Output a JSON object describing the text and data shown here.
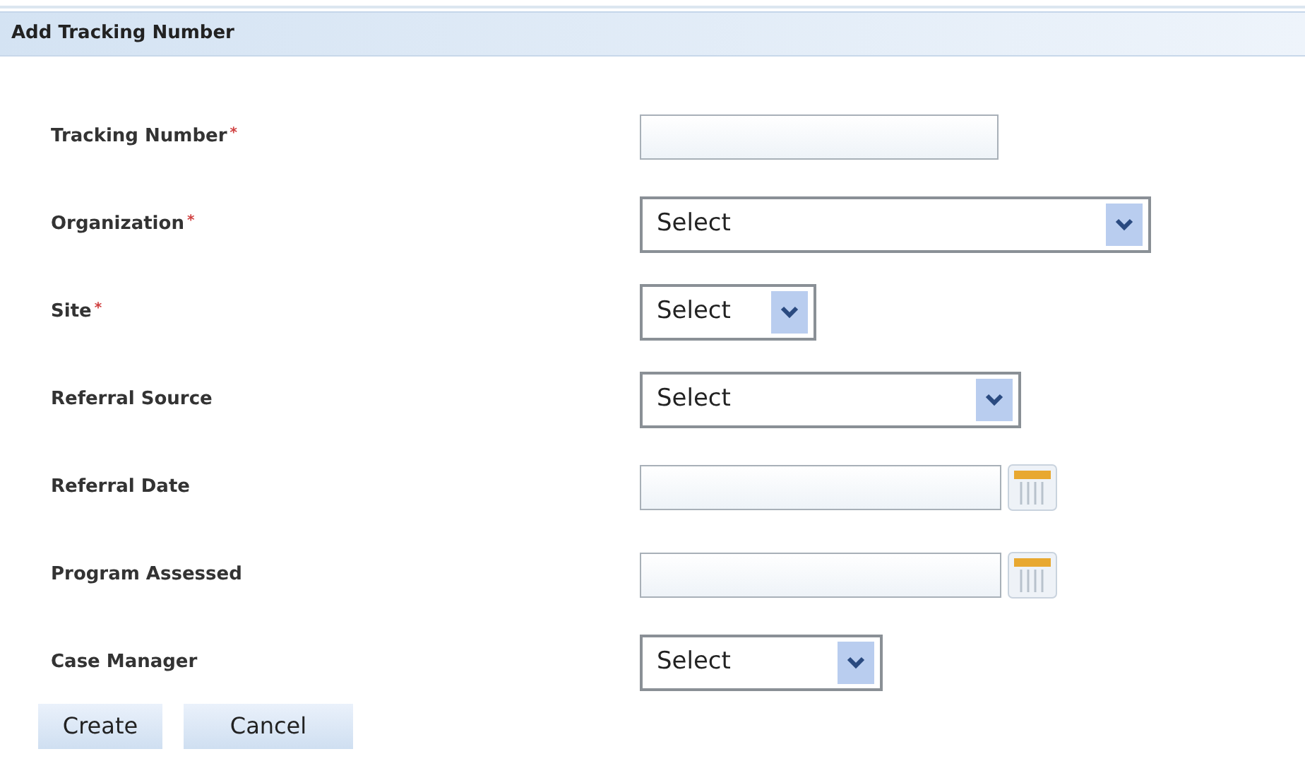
{
  "panel": {
    "title": "Add Tracking Number"
  },
  "fields": [
    {
      "label": "Tracking Number",
      "required_mark": "*",
      "kind": "text"
    },
    {
      "label": "Organization",
      "required_mark": "*",
      "kind": "select",
      "value": "Select"
    },
    {
      "label": "Site",
      "required_mark": "*",
      "kind": "select",
      "value": "Select"
    },
    {
      "label": "Referral Source",
      "kind": "select",
      "value": "Select"
    },
    {
      "label": "Referral Date",
      "kind": "date"
    },
    {
      "label": "Program Assessed",
      "kind": "date"
    },
    {
      "label": "Case Manager",
      "kind": "select",
      "value": "Select"
    }
  ],
  "buttons": [
    "Create",
    "Cancel"
  ]
}
